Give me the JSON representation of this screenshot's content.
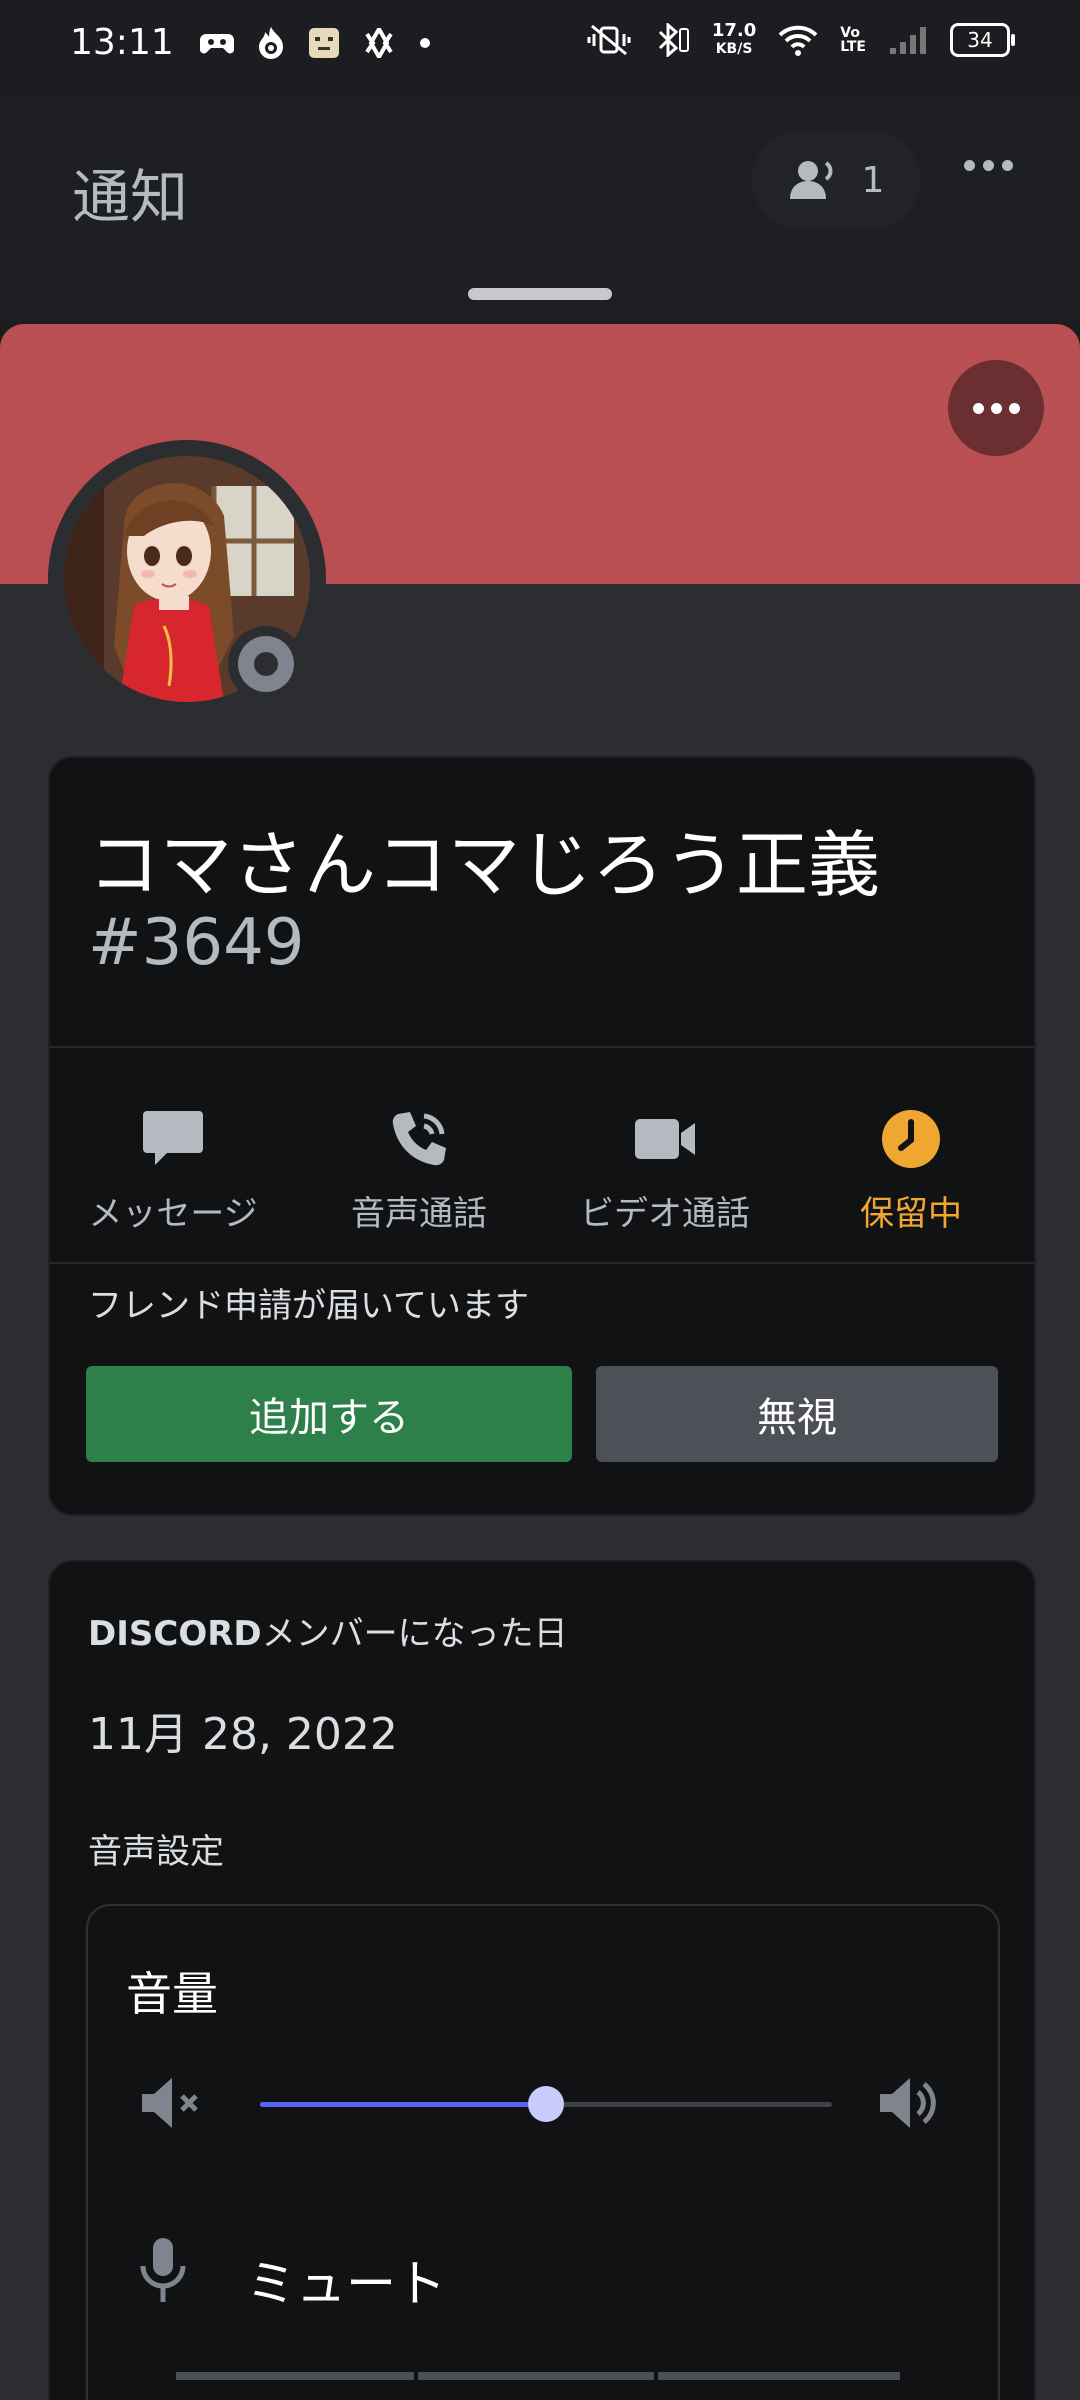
{
  "status_bar": {
    "time": "13:11",
    "net_speed_value": "17.0",
    "net_speed_unit": "KB/S",
    "volte": "Vo\nLTE",
    "battery": "34"
  },
  "background": {
    "title": "通知",
    "call_count": "1"
  },
  "profile": {
    "username": "コマさんコマじろう正義",
    "tag": "#3649",
    "status": "offline",
    "banner_color": "#b94f52"
  },
  "actions": [
    {
      "label": "メッセージ",
      "icon": "message-icon"
    },
    {
      "label": "音声通話",
      "icon": "phone-icon"
    },
    {
      "label": "ビデオ通話",
      "icon": "video-icon"
    },
    {
      "label": "保留中",
      "icon": "clock-icon"
    }
  ],
  "friend_request": {
    "label": "フレンド申請が届いています",
    "accept_label": "追加する",
    "ignore_label": "無視"
  },
  "member_since": {
    "label_brand": "DISCORD",
    "label_rest": "メンバーになった日",
    "date": "11月 28, 2022"
  },
  "voice_settings": {
    "section_label": "音声設定",
    "volume_label": "音量",
    "volume_level": 0.5,
    "mute_label": "ミュート"
  },
  "colors": {
    "accent": "#5865f2",
    "accept_green": "#2d8049",
    "pending_orange": "#f0a731"
  }
}
